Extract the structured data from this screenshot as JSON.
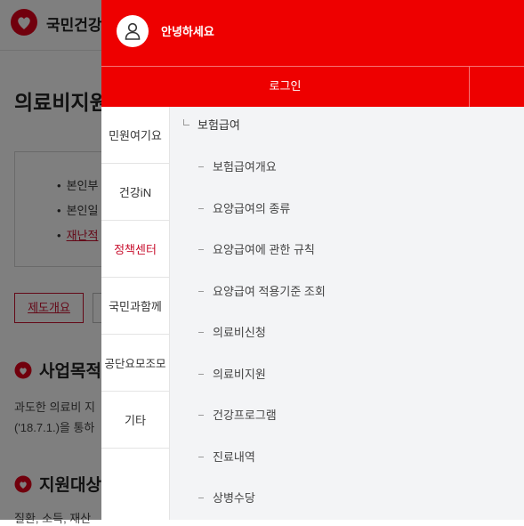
{
  "background": {
    "site_name": "국민건강",
    "page_title": "의료비지원",
    "info_lines": [
      "본인부",
      "본인일",
      "재난적"
    ],
    "tab_button": "제도개요",
    "section1_title": "사업목적",
    "section1_text": [
      "과도한 의료비 지",
      "('18.7.1.)을 통하"
    ],
    "section2_title": "지원대상",
    "section2_text": "질환, 소득, 재산"
  },
  "drawer": {
    "greeting": "안녕하세요",
    "login_label": "로그인",
    "categories": [
      {
        "label": "민원여기요"
      },
      {
        "label": "건강iN"
      },
      {
        "label": "정책센터"
      },
      {
        "label": "국민과함께"
      },
      {
        "label": "공단요모조모"
      },
      {
        "label": "기타"
      }
    ],
    "active_category": "정책센터",
    "submenu": {
      "heading": "보험급여",
      "items": [
        "보험급여개요",
        "요양급여의 종류",
        "요양급여에 관한 규칙",
        "요양급여 적용기준 조회",
        "의료비신청",
        "의료비지원",
        "건강프로그램",
        "진료내역",
        "상병수당"
      ]
    }
  },
  "colors": {
    "brand_red": "#ee0000",
    "accent_red": "#c8102e"
  },
  "icons": {
    "logo": "heart-logo-icon",
    "avatar": "user-avatar-icon"
  }
}
